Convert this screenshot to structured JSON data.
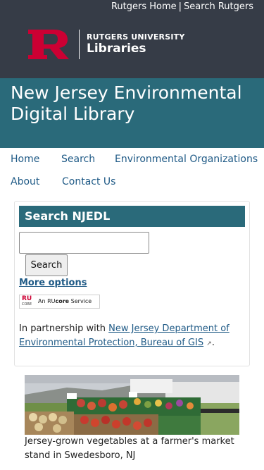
{
  "header": {
    "util_links": [
      "Rutgers Home",
      "Search Rutgers"
    ],
    "util_separator": "|",
    "logo_line1": "RUTGERS UNIVERSITY",
    "logo_line2": "Libraries",
    "logo_letter": "R",
    "colors": {
      "background": "#363c47",
      "logo_red": "#cc0033"
    }
  },
  "title_band": {
    "title": "New Jersey Environmental Digital Library",
    "color": "#2a6a7a"
  },
  "nav": {
    "items": [
      "Home",
      "Search",
      "Environmental Organizations",
      "About",
      "Contact Us"
    ],
    "link_color": "#1f5a86"
  },
  "search_panel": {
    "heading": "Search NJEDL",
    "input_value": "",
    "button_label": "Search",
    "more_options_label": "More options",
    "rucore_badge": {
      "logo_text": "RU",
      "logo_sub": "CORE",
      "prefix": "An RU",
      "bold": "core",
      "suffix": " Service"
    },
    "partnership_prefix": "In partnership with ",
    "partnership_link": "New Jersey Department of Environmental Protection, Bureau of GIS",
    "partnership_suffix": ".",
    "external_icon": "external-link-icon"
  },
  "feature": {
    "caption": "Jersey-grown vegetables at a farmer's market stand in Swedesboro, NJ"
  }
}
